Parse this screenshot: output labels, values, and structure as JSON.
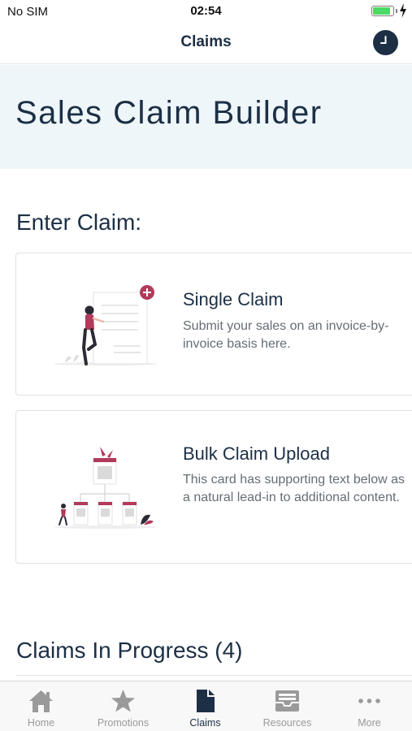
{
  "status_bar": {
    "carrier": "No SIM",
    "time": "02:54",
    "battery_level": 0.9
  },
  "nav": {
    "title": "Claims",
    "history_icon": "clock-icon"
  },
  "hero": {
    "title": "Sales Claim Builder"
  },
  "enter_claim": {
    "heading": "Enter Claim:",
    "cards": [
      {
        "title": "Single Claim",
        "text": "Submit your sales on an invoice-by-invoice basis here.",
        "illustration": "person-with-document-illustration"
      },
      {
        "title": "Bulk Claim Upload",
        "text": "This card has supporting text below as a natural lead-in to additional content.",
        "illustration": "org-chart-illustration"
      }
    ]
  },
  "in_progress": {
    "heading": "Claims In Progress (4)"
  },
  "tab_bar": {
    "items": [
      {
        "label": "Home",
        "icon": "home-icon"
      },
      {
        "label": "Promotions",
        "icon": "star-icon"
      },
      {
        "label": "Claims",
        "icon": "document-icon"
      },
      {
        "label": "Resources",
        "icon": "inbox-icon"
      },
      {
        "label": "More",
        "icon": "more-icon"
      }
    ],
    "active": "Claims"
  },
  "colors": {
    "primary": "#1c2f45",
    "accent": "#b23a5b",
    "hero_bg": "#eef6fa",
    "battery": "#4cd964"
  }
}
